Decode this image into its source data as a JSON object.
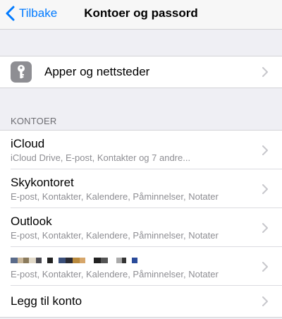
{
  "navbar": {
    "back_label": "Tilbake",
    "title": "Kontoer og passord"
  },
  "apps": {
    "label": "Apper og nettsteder",
    "icon": "key-icon"
  },
  "accounts_section": {
    "header": "KONTOER",
    "items": [
      {
        "name": "iCloud",
        "detail": "iCloud Drive, E-post, Kontakter og 7 andre..."
      },
      {
        "name": "Skykontoret",
        "detail": "E-post, Kontakter, Kalendere, Påminnelser, Notater"
      },
      {
        "name": "Outlook",
        "detail": "E-post, Kontakter, Kalendere, Påminnelser, Notater"
      },
      {
        "name": "",
        "detail": "E-post, Kontakter, Kalendere, Påminnelser, Notater"
      }
    ],
    "add_label": "Legg til konto"
  },
  "colors": {
    "accent": "#007aff",
    "background": "#efeff4",
    "secondary_text": "#8e8e93",
    "chevron": "#c7c7cc"
  }
}
